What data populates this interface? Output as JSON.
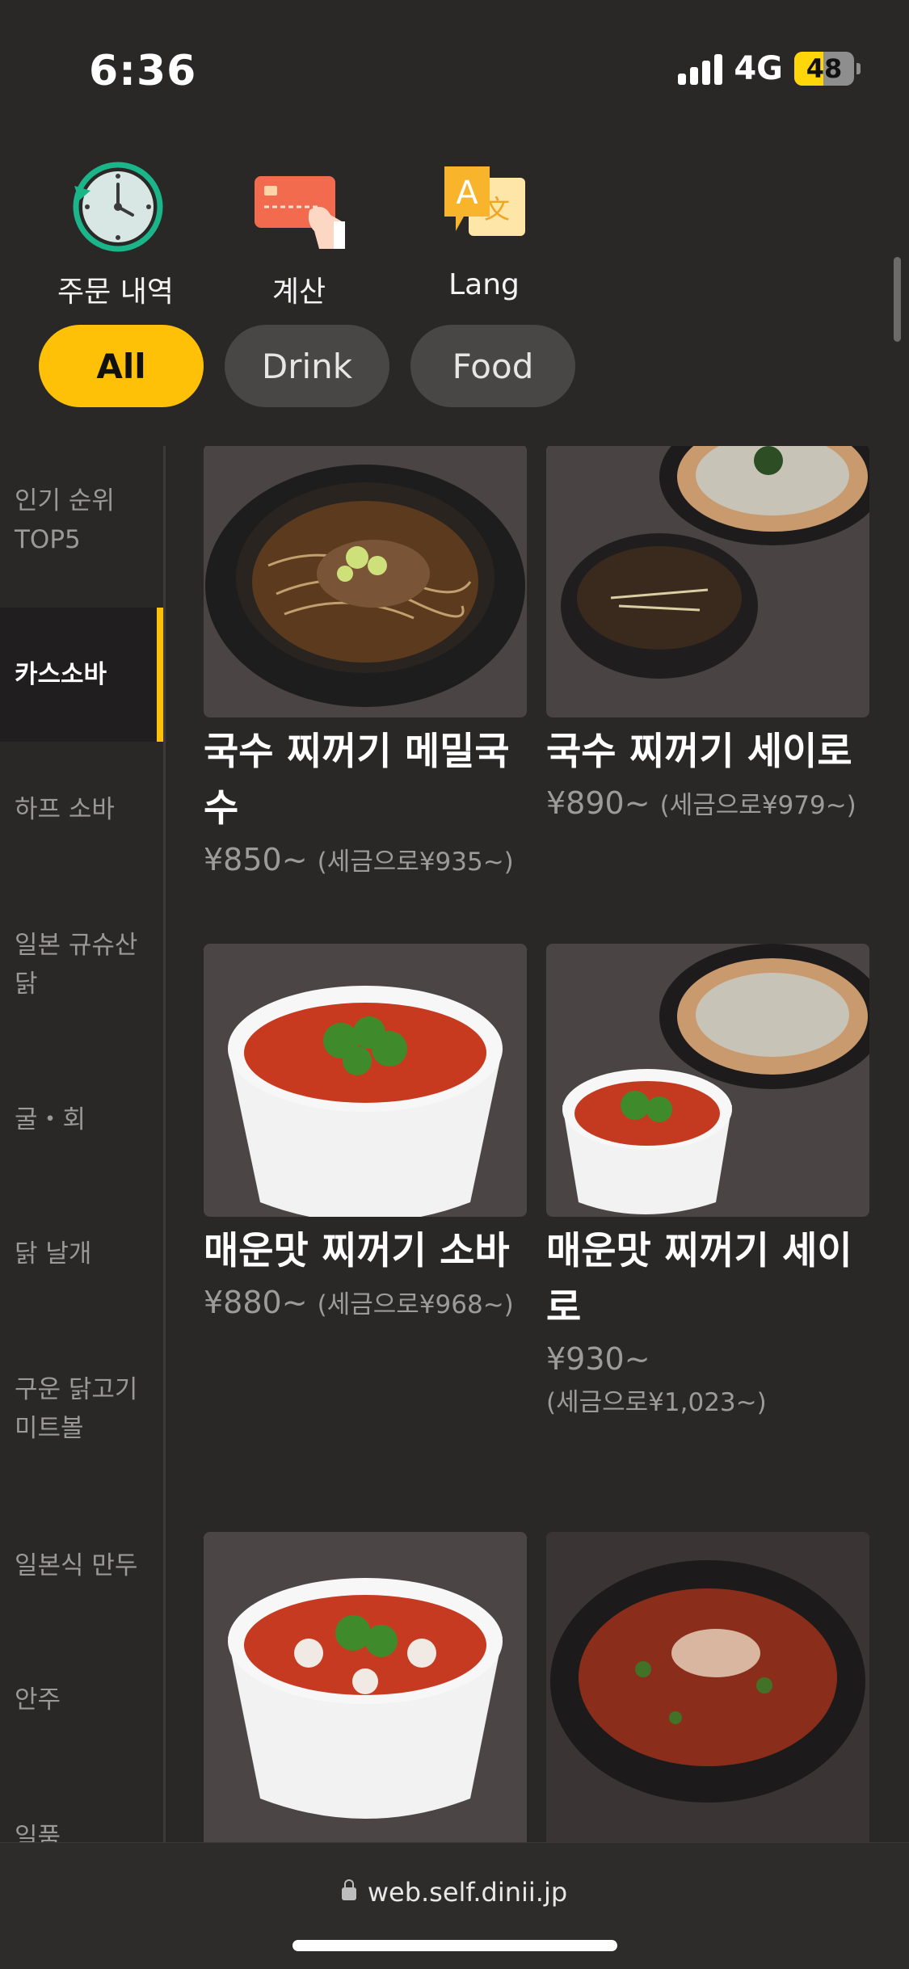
{
  "status_bar": {
    "time": "6:36",
    "network": "4G",
    "battery": "48",
    "battery_level": 0.48
  },
  "top_actions": [
    {
      "label": "주문 내역",
      "icon": "clock-icon"
    },
    {
      "label": "계산",
      "icon": "credit-card-icon"
    },
    {
      "label": "Lang",
      "icon": "translate-icon"
    }
  ],
  "filters": {
    "items": [
      "All",
      "Drink",
      "Food"
    ],
    "selected": "All"
  },
  "sidebar": {
    "items": [
      {
        "label": "인기 순위 TOP5"
      },
      {
        "label": "카스소바"
      },
      {
        "label": "하프 소바"
      },
      {
        "label": "일본 규슈산 닭"
      },
      {
        "label": "굴・회"
      },
      {
        "label": "닭 날개"
      },
      {
        "label": "구운 닭고기 미트볼"
      },
      {
        "label": "일본식 만두"
      },
      {
        "label": "안주"
      },
      {
        "label": "일품"
      }
    ],
    "selected": "카스소바"
  },
  "menu": {
    "items": [
      {
        "name": "국수 찌꺼기 메밀국수",
        "price": "¥850~",
        "tax": "(세금으로¥935~)",
        "photo": "soy-broth-soba"
      },
      {
        "name": "국수 찌꺼기 세이로",
        "price": "¥890~",
        "tax": "(세금으로¥979~)",
        "photo": "seiro-soba-dip"
      },
      {
        "name": "매운맛 찌꺼기 소바",
        "price": "¥880~",
        "tax": "(세금으로¥968~)",
        "photo": "spicy-soba"
      },
      {
        "name": "매운맛 찌꺼기 세이로",
        "price": "¥930~",
        "tax": "(세금으로¥1,023~)",
        "photo": "spicy-seiro"
      },
      {
        "name": "",
        "price": "",
        "tax": "",
        "photo": "spicy-soba-chicken"
      },
      {
        "name": "",
        "price": "",
        "tax": "",
        "photo": "spicy-soba-pork"
      }
    ]
  },
  "browser": {
    "url": "web.self.dinii.jp"
  },
  "colors": {
    "accent": "#ffc107",
    "background": "#2a2727"
  }
}
